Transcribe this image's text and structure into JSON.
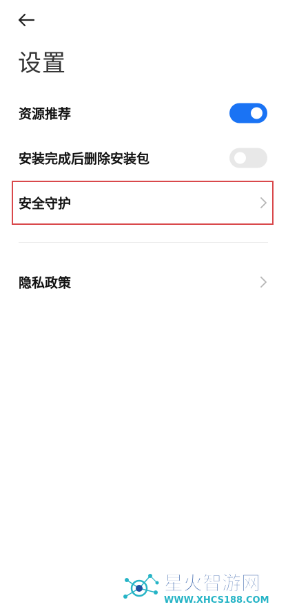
{
  "header": {
    "back_icon": "arrow-left-icon",
    "title": "设置"
  },
  "settings": {
    "items": [
      {
        "label": "资源推荐",
        "control": "toggle",
        "state": true
      },
      {
        "label": "安装完成后删除安装包",
        "control": "toggle",
        "state": false
      },
      {
        "label": "安全守护",
        "control": "chevron",
        "highlighted": true
      },
      {
        "label": "隐私政策",
        "control": "chevron"
      }
    ]
  },
  "watermark": {
    "brand": "星火智游网",
    "url": "WWW.XHCS188.COM"
  },
  "colors": {
    "toggle_on": "#1a73f4",
    "toggle_off": "#e8e8e8",
    "highlight": "#d9484b",
    "chevron": "#b5b5b5",
    "brand_blue": "#1e4fa0",
    "brand_cyan": "#26b4c6"
  }
}
